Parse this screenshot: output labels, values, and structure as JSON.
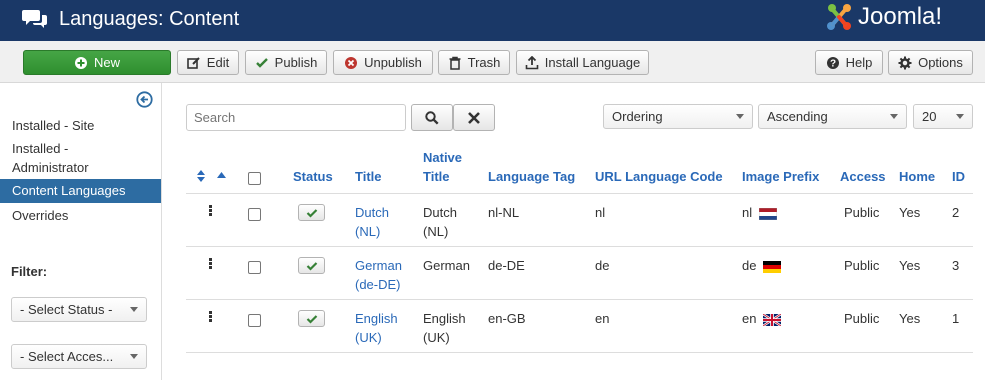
{
  "header": {
    "title": "Languages: Content",
    "logo_text": "Joomla!",
    "brand_color": "#1a3867"
  },
  "toolbar": {
    "new": "New",
    "edit": "Edit",
    "publish": "Publish",
    "unpublish": "Unpublish",
    "trash": "Trash",
    "install_language": "Install Language",
    "help": "Help",
    "options": "Options"
  },
  "sidebar": {
    "items": [
      {
        "label": "Installed - Site"
      },
      {
        "label": "Installed - Administrator"
      },
      {
        "label": "Content Languages",
        "active": true
      },
      {
        "label": "Overrides"
      }
    ],
    "filter_title": "Filter:",
    "select_status": "- Select Status -",
    "select_access": "- Select Acces..."
  },
  "search": {
    "placeholder": "Search"
  },
  "list": {
    "ordering": "Ordering",
    "direction": "Ascending",
    "limit": "20"
  },
  "table": {
    "headers": {
      "status": "Status",
      "title": "Title",
      "native_title": "Native Title",
      "language_tag": "Language Tag",
      "url_code": "URL Language Code",
      "image_prefix": "Image Prefix",
      "access": "Access",
      "home": "Home",
      "id": "ID"
    },
    "rows": [
      {
        "title": "Dutch (NL)",
        "native": "Dutch (NL)",
        "tag": "nl-NL",
        "url": "nl",
        "image": "nl",
        "flag": "nl-flag-icon",
        "access": "Public",
        "home": "Yes",
        "id": "2"
      },
      {
        "title": "German (de-DE)",
        "native": "German",
        "tag": "de-DE",
        "url": "de",
        "image": "de",
        "flag": "de-flag-icon",
        "access": "Public",
        "home": "Yes",
        "id": "3"
      },
      {
        "title": "English (UK)",
        "native": "English (UK)",
        "tag": "en-GB",
        "url": "en",
        "image": "en",
        "flag": "gb-flag-icon",
        "access": "Public",
        "home": "Yes",
        "id": "1"
      }
    ]
  }
}
